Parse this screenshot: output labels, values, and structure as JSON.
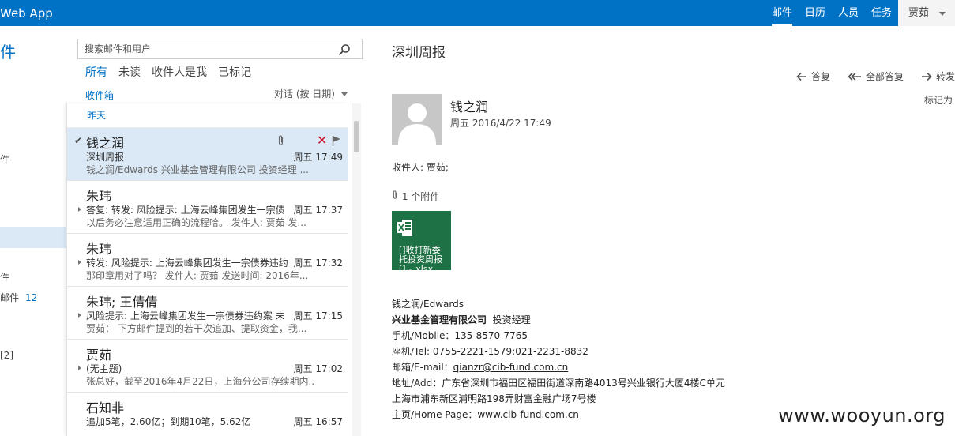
{
  "app": {
    "title": "Web App"
  },
  "topnav": {
    "items": [
      "邮件",
      "日历",
      "人员",
      "任务"
    ],
    "user": "贾茹"
  },
  "folders": {
    "heading": "件",
    "items": [
      {
        "label": "件"
      },
      {
        "label": "件"
      },
      {
        "label": "邮件",
        "count": "12"
      },
      {
        "label": "[2]"
      }
    ]
  },
  "list": {
    "search_placeholder": "搜索邮件和用户",
    "filters": [
      "所有",
      "未读",
      "收件人是我",
      "已标记"
    ],
    "folder_name": "收件箱",
    "sort_label": "对话 (按 日期)",
    "group_label": "昨天",
    "messages": [
      {
        "sender": "钱之润",
        "subject": "深圳周报",
        "time": "周五 17:49",
        "preview": "钱之润/Edwards 兴业基金管理有限公司 投资经理 ..."
      },
      {
        "sender": "朱玮",
        "subject": "答复: 转发: 风险提示: 上海云峰集团发生一宗债",
        "time": "周五 17:37",
        "preview": "以后务必注意适用正确的流程哈。   发件人: 贾茹  发..."
      },
      {
        "sender": "朱玮",
        "subject": "转发: 风险提示: 上海云峰集团发生一宗债券违约",
        "time": "周五 17:32",
        "preview": "那印章用对了吗？   发件人: 贾茹  发送时间: 2016年..."
      },
      {
        "sender": "朱玮; 王倩倩",
        "subject": "风险提示: 上海云峰集团发生一宗债券违约案 未",
        "time": "周五 17:15",
        "preview": "贾茹：  下方邮件提到的若干次追加、提取资金，我..."
      },
      {
        "sender": "贾茹",
        "subject": "(无主题)",
        "time": "周五 17:02",
        "preview": "张总好，截至2016年4月22日，上海分公司存续期内..."
      },
      {
        "sender": "石知非",
        "subject": "追加5笔，2.60亿；到期10笔，5.62亿",
        "time": "周五 16:57",
        "preview": ""
      }
    ]
  },
  "reading": {
    "subject": "深圳周报",
    "actions": {
      "reply": "答复",
      "reply_all": "全部答复",
      "forward": "转发"
    },
    "mark_as": "标记为",
    "from_name": "钱之润",
    "from_date": "周五 2016/4/22 17:49",
    "to_line": "收件人:  贾茹;",
    "attachment_count": "1 个附件",
    "attachment_name": "[]收打新委托投资周报[]~.xlsx",
    "signature": {
      "line1": "钱之润/Edwards",
      "company": "兴业基金管理有限公司",
      "title": "投资经理",
      "mobile": "手机/Mobile：135-8570-7765",
      "tel": "座机/Tel: 0755-2221-1579;021-2231-8832",
      "email_label": "邮箱/E-mail：",
      "email": "qianzr@cib-fund.com.cn",
      "addr": "地址/Add：广东省深圳市福田区福田街道深南路4013号兴业银行大厦4楼C单元",
      "addr2": "上海市浦东新区浦明路198弄财富金融广场7号楼",
      "home_label": "主页/Home Page：",
      "home": "www.cib-fund.com.cn"
    }
  },
  "watermark": "www.wooyun.org",
  "colors": {
    "brand": "#0072c6",
    "selected": "#dbe9f6",
    "excel": "#1e7145",
    "delete": "#c8102e"
  }
}
